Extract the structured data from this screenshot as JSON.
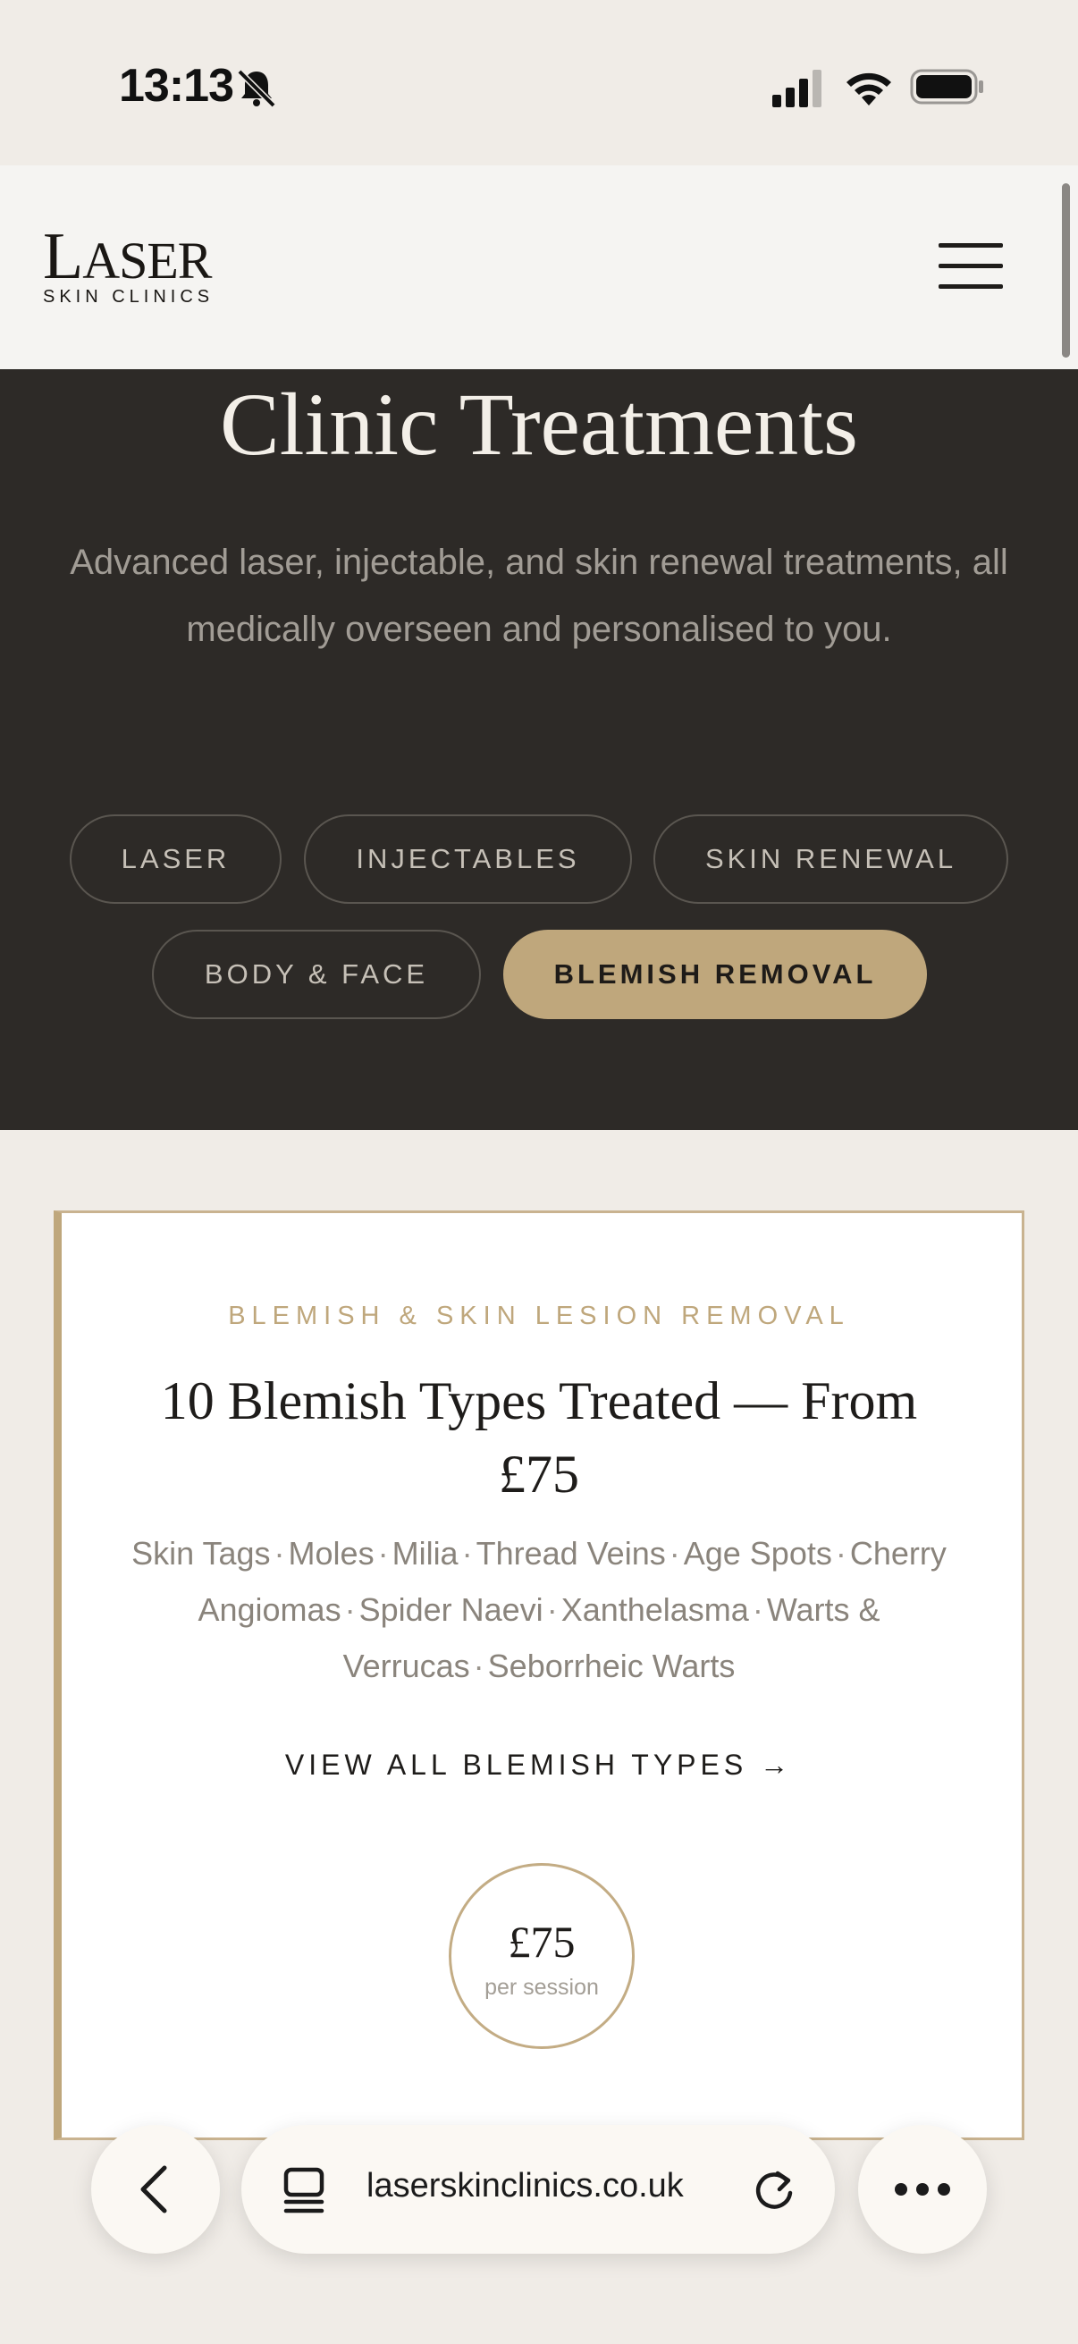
{
  "status_bar": {
    "time": "13:13",
    "icons": [
      "bell-muted-icon",
      "cellular-signal-icon",
      "wifi-icon",
      "battery-icon"
    ]
  },
  "header": {
    "logo_big_letter": "L",
    "logo_rest": "ASER",
    "logo_sub": "SKIN CLINICS",
    "menu_icon": "hamburger-menu-icon"
  },
  "hero": {
    "title": "Clinic Treatments",
    "description": "Advanced laser, injectable, and skin renewal treatments, all medically overseen and personalised to you.",
    "filters": [
      {
        "label": "LASER",
        "active": false
      },
      {
        "label": "INJECTABLES",
        "active": false
      },
      {
        "label": "SKIN RENEWAL",
        "active": false
      },
      {
        "label": "BODY & FACE",
        "active": false
      },
      {
        "label": "BLEMISH REMOVAL",
        "active": true
      }
    ]
  },
  "card": {
    "eyebrow": "BLEMISH & SKIN LESION REMOVAL",
    "title": "10 Blemish Types Treated — From £75",
    "types": [
      "Skin Tags",
      "Moles",
      "Milia",
      "Thread Veins",
      "Age Spots",
      "Cherry Angiomas",
      "Spider Naevi",
      "Xanthelasma",
      "Warts & Verrucas",
      "Seborrheic Warts"
    ],
    "separator": "·",
    "link_label": "VIEW ALL BLEMISH TYPES →",
    "price": "£75",
    "price_unit": "per session"
  },
  "browser": {
    "url": "laserskinclinics.co.uk",
    "icons": [
      "back-arrow-icon",
      "tabs-icon",
      "reload-icon",
      "more-icon"
    ]
  },
  "colors": {
    "accent_gold": "#bfa77c",
    "hero_bg": "#2d2a27",
    "page_bg": "#f0ece7"
  }
}
